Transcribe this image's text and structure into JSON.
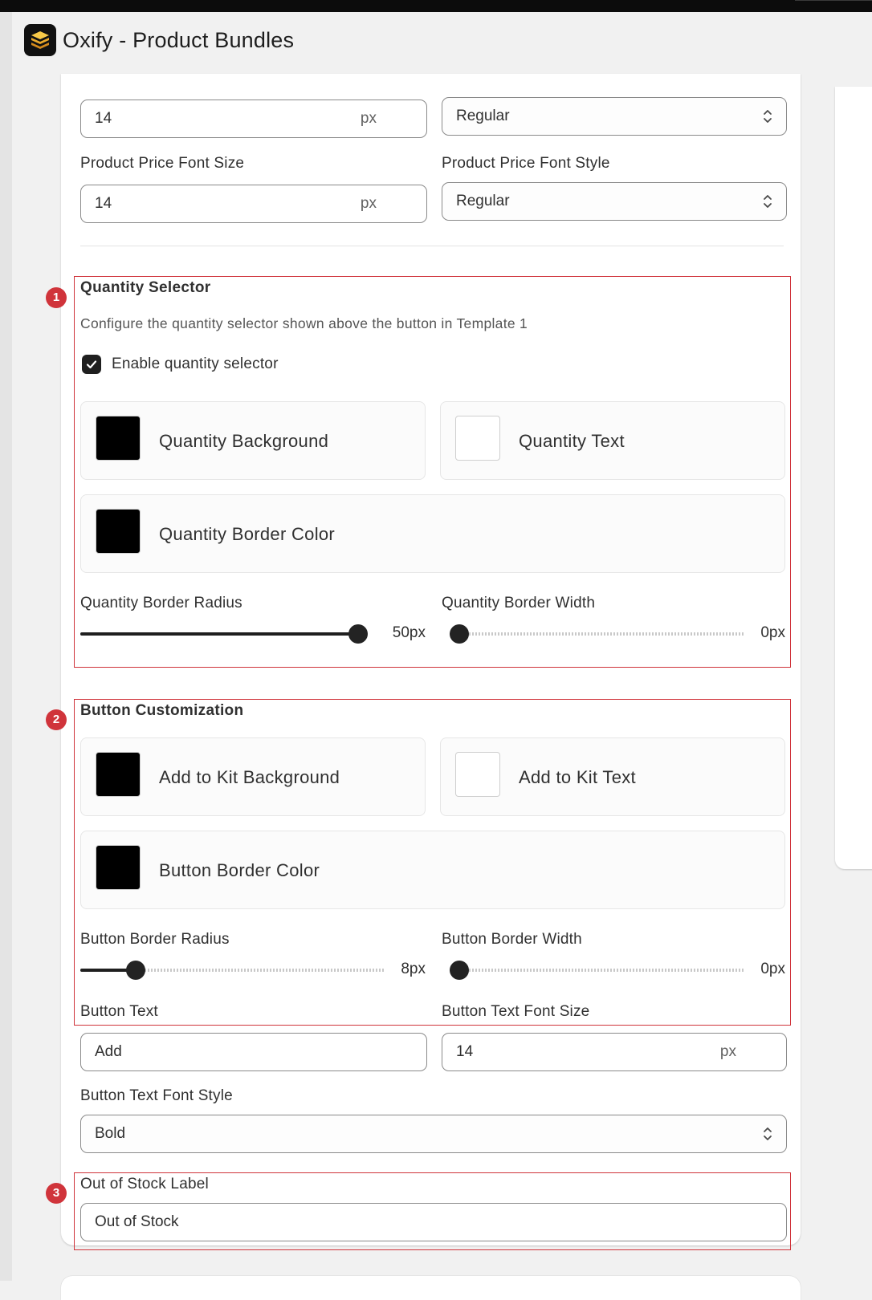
{
  "app": {
    "title": "Oxify - Product Bundles"
  },
  "top_fields": {
    "size_value": "14",
    "size_suffix": "px",
    "style_value": "Regular"
  },
  "price": {
    "size_label": "Product Price Font Size",
    "size_value": "14",
    "size_suffix": "px",
    "style_label": "Product Price Font Style",
    "style_value": "Regular"
  },
  "quantity_selector": {
    "badge": "1",
    "heading": "Quantity Selector",
    "help": "Configure the quantity selector shown above the button in Template 1",
    "enable_label": "Enable quantity selector",
    "enabled": true,
    "background": {
      "label": "Quantity Background",
      "color": "#000000"
    },
    "text": {
      "label": "Quantity Text",
      "color": "#ffffff"
    },
    "border_color": {
      "label": "Quantity Border Color",
      "color": "#000000"
    },
    "border_radius": {
      "label": "Quantity Border Radius",
      "value": 50,
      "max": 50,
      "display": "50px"
    },
    "border_width": {
      "label": "Quantity Border Width",
      "value": 0,
      "max": 10,
      "display": "0px"
    }
  },
  "button_customization": {
    "badge": "2",
    "heading": "Button Customization",
    "background": {
      "label": "Add to Kit Background",
      "color": "#000000"
    },
    "text": {
      "label": "Add to Kit Text",
      "color": "#ffffff"
    },
    "border_color": {
      "label": "Button Border Color",
      "color": "#000000"
    },
    "border_radius": {
      "label": "Button Border Radius",
      "value": 8,
      "max": 50,
      "display": "8px"
    },
    "border_width": {
      "label": "Button Border Width",
      "value": 0,
      "max": 10,
      "display": "0px"
    },
    "button_text_label": "Button Text",
    "button_text_value": "Add",
    "font_size_label": "Button Text Font Size",
    "font_size_value": "14",
    "font_size_suffix": "px",
    "font_style_label": "Button Text Font Style",
    "font_style_value": "Bold"
  },
  "out_of_stock": {
    "badge": "3",
    "label": "Out of Stock Label",
    "value": "Out of Stock"
  },
  "colors": {
    "annotation": "#d0343b",
    "accent": "#1f1f1f"
  }
}
